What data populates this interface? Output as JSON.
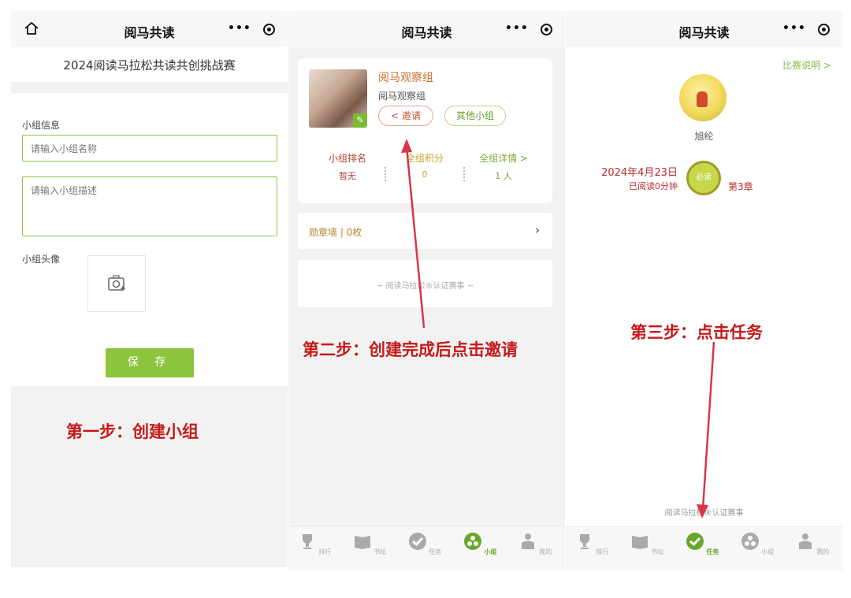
{
  "panel1": {
    "app_title": "阅马共读",
    "header": "2024阅读马拉松共读共创挑战赛",
    "group_info_label": "小组信息",
    "name_placeholder": "请输入小组名称",
    "desc_placeholder": "请输入小组描述",
    "avatar_label": "小组头像",
    "save_label": "保 存",
    "step": "第一步：创建小组"
  },
  "panel2": {
    "app_title": "阅马共读",
    "group_name": "阅马观察组",
    "group_sub": "阅马观察组",
    "invite_label": "邀请",
    "other_groups_label": "其他小组",
    "stats": [
      {
        "key": "小组排名",
        "value": "暂无"
      },
      {
        "key": "全组积分",
        "value": "0"
      },
      {
        "key": "全组详情 >",
        "value": "1 人"
      }
    ],
    "badge_wall": "勋章墙 | 0枚",
    "cert_text": "~ 阅读马拉松®认证赛事 ~",
    "step": "第二步：创建完成后点击邀请"
  },
  "panel3": {
    "app_title": "阅马共读",
    "rules_link": "比赛说明 >",
    "user_name": "旭纶",
    "date": "2024年4月23日",
    "read_time": "已阅读0分钟",
    "must_read": "必读",
    "chapter": "第3章",
    "cert_text": "阅读马拉松®认证赛事",
    "step": "第三步：点击任务"
  },
  "tabs": [
    "排行",
    "书坛",
    "任务",
    "小组",
    "我的"
  ],
  "colors": {
    "accent": "#8cc43c",
    "annotation": "#c41a1a",
    "arrow": "#d9364b"
  }
}
